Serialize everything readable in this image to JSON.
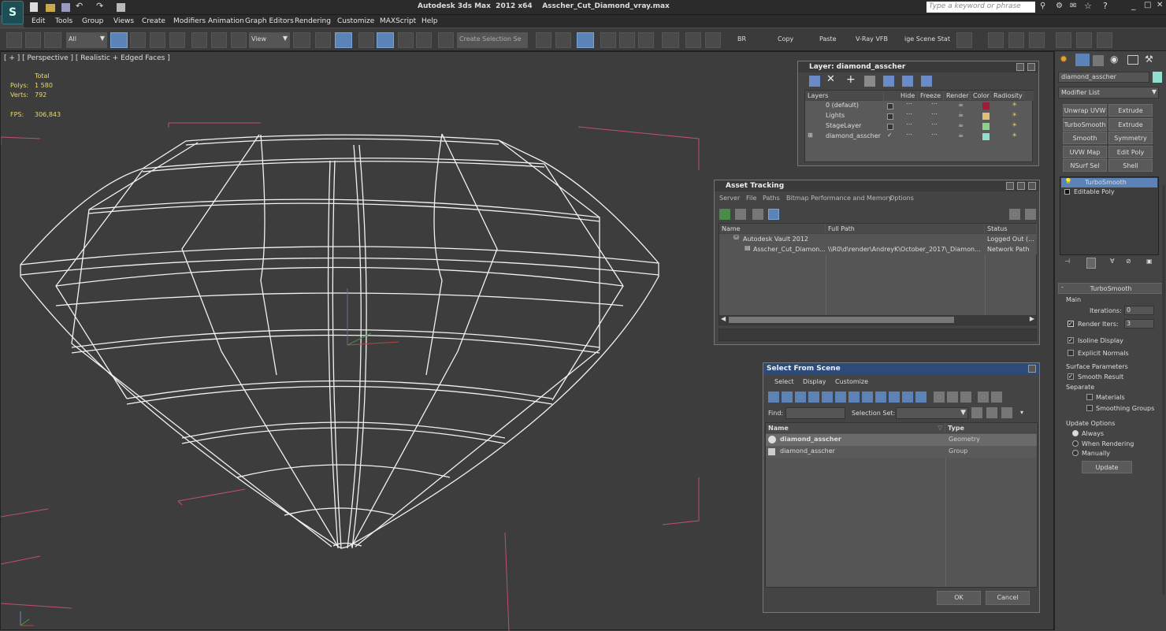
{
  "app": {
    "title": "Autodesk 3ds Max  2012 x64    Asscher_Cut_Diamond_vray.max",
    "search_placeholder": "Type a keyword or phrase"
  },
  "menu": [
    "Edit",
    "Tools",
    "Group",
    "Views",
    "Create",
    "Modifiers",
    "Animation",
    "Graph Editors",
    "Rendering",
    "Customize",
    "MAXScript",
    "Help"
  ],
  "toolbar": {
    "filter_value": "All",
    "refcoord_value": "View",
    "selection_set_placeholder": "Create Selection Se",
    "br_label": "BR",
    "copy_label": "Copy",
    "paste_label": "Paste",
    "vfb_label": "V-Ray VFB",
    "scene_label": "ige Scene Stat"
  },
  "viewport": {
    "label": "[ + ] [ Perspective ] [ Realistic + Edged Faces ]",
    "stats": {
      "total_label": "Total",
      "polys_label": "Polys:",
      "polys_value": "1 580",
      "verts_label": "Verts:",
      "verts_value": "792",
      "fps_label": "FPS:",
      "fps_value": "306,843"
    }
  },
  "layer_window": {
    "title": "Layer: diamond_asscher",
    "columns": [
      "Layers",
      "Hide",
      "Freeze",
      "Render",
      "Color",
      "Radiosity"
    ],
    "rows": [
      {
        "name": "0 (default)",
        "color": "#a01c3a"
      },
      {
        "name": "Lights",
        "color": "#e0c070"
      },
      {
        "name": "StageLayer",
        "color": "#8fd08f"
      },
      {
        "name": "diamond_asscher",
        "color": "#8fdfd0"
      }
    ]
  },
  "asset_tracking": {
    "title": "Asset Tracking",
    "menu": [
      "Server",
      "File",
      "Paths",
      "Bitmap Performance and Memory",
      "Options"
    ],
    "columns": [
      "Name",
      "Full Path",
      "Status"
    ],
    "rows": [
      {
        "name": "Autodesk Vault 2012",
        "path": "",
        "status": "Logged Out (..."
      },
      {
        "name": "Asscher_Cut_Diamon...",
        "path": "\\\\R0\\d\\render\\AndreyK\\October_2017\\_Diamon...",
        "status": "Network Path"
      }
    ]
  },
  "select_scene": {
    "title": "Select From Scene",
    "menu": [
      "Select",
      "Display",
      "Customize"
    ],
    "find_label": "Find:",
    "selset_label": "Selection Set:",
    "columns": [
      "Name",
      "Type"
    ],
    "rows": [
      {
        "name": "diamond_asscher",
        "type": "Geometry"
      },
      {
        "name": "diamond_asscher",
        "type": "Group"
      }
    ],
    "ok_label": "OK",
    "cancel_label": "Cancel"
  },
  "command_panel": {
    "object_name": "diamond_asscher",
    "modifier_list_label": "Modifier List",
    "modifier_buttons": [
      "Unwrap UVW",
      "Extrude",
      "TurboSmooth",
      "Extrude",
      "Smooth",
      "Symmetry",
      "UVW Map",
      "Edit Poly",
      "NSurf Sel",
      "Shell"
    ],
    "stack": [
      "TurboSmooth",
      "Editable Poly"
    ],
    "rollout_title": "TurboSmooth",
    "main_label": "Main",
    "iterations_label": "Iterations:",
    "iterations_value": "0",
    "render_iters_label": "Render Iters:",
    "render_iters_value": "3",
    "isoline_label": "Isoline Display",
    "explicit_normals_label": "Explicit Normals",
    "surface_params_label": "Surface Parameters",
    "smooth_result_label": "Smooth Result",
    "separate_label": "Separate",
    "materials_label": "Materials",
    "smoothing_groups_label": "Smoothing Groups",
    "update_options_label": "Update Options",
    "always_label": "Always",
    "when_rendering_label": "When Rendering",
    "manually_label": "Manually",
    "update_button": "Update"
  }
}
